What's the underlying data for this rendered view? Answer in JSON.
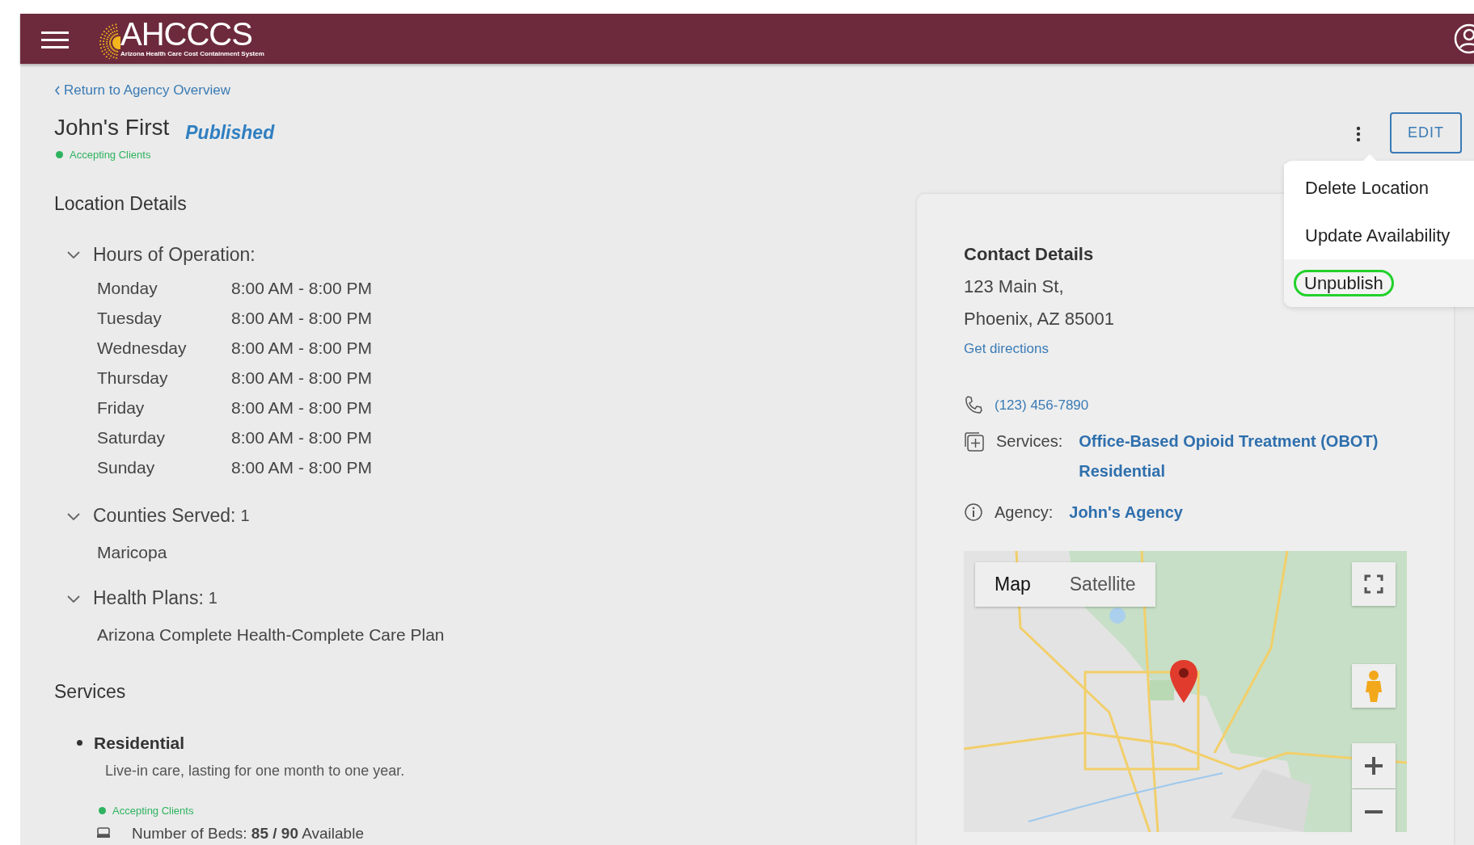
{
  "header": {
    "logo_text": "AHCCCS",
    "logo_subtitle": "Arizona Health Care Cost Containment System"
  },
  "back_link": "Return to Agency Overview",
  "location": {
    "name": "John's First",
    "status": "Published",
    "availability": "Accepting Clients"
  },
  "actions": {
    "edit": "EDIT",
    "menu": [
      {
        "label": "Delete Location",
        "selected": false
      },
      {
        "label": "Update Availability",
        "selected": false
      },
      {
        "label": "Unpublish",
        "selected": true
      }
    ]
  },
  "location_details": {
    "title": "Location Details",
    "sections": [
      {
        "kind": "hours",
        "title": "Hours of Operation:",
        "expanded": true,
        "rows": [
          {
            "day": "Monday",
            "hours": "8:00 AM - 8:00 PM"
          },
          {
            "day": "Tuesday",
            "hours": "8:00 AM - 8:00 PM"
          },
          {
            "day": "Wednesday",
            "hours": "8:00 AM - 8:00 PM"
          },
          {
            "day": "Thursday",
            "hours": "8:00 AM - 8:00 PM"
          },
          {
            "day": "Friday",
            "hours": "8:00 AM - 8:00 PM"
          },
          {
            "day": "Saturday",
            "hours": "8:00 AM - 8:00 PM"
          },
          {
            "day": "Sunday",
            "hours": "8:00 AM - 8:00 PM"
          }
        ]
      },
      {
        "kind": "list",
        "title": "Counties Served:",
        "count": "1",
        "expanded": true,
        "items": [
          "Maricopa"
        ]
      },
      {
        "kind": "list",
        "title": "Health Plans:",
        "count": "1",
        "expanded": true,
        "items": [
          "Arizona Complete Health-Complete Care Plan"
        ]
      }
    ]
  },
  "services": {
    "title": "Services",
    "items": [
      {
        "name": "Residential",
        "description": "Live-in care, lasting for one month to one year.",
        "availability": "Accepting Clients",
        "beds": "Number of Beds: **85 / 90** Available"
      }
    ]
  },
  "contact": {
    "title": "Contact Details",
    "address": [
      "123 Main St,",
      "Phoenix, AZ 85001"
    ],
    "directions": "Get directions",
    "phone": "(123) 456-7890",
    "services_label": "Services:",
    "services": [
      "Office-Based Opioid Treatment (OBOT)",
      "Residential"
    ],
    "agency_label": "Agency:",
    "agency": "John's Agency"
  },
  "map": {
    "kind": "picture",
    "map_types": [
      {
        "label": "Map",
        "selected": true
      },
      {
        "label": "Satellite",
        "selected": false
      }
    ]
  }
}
